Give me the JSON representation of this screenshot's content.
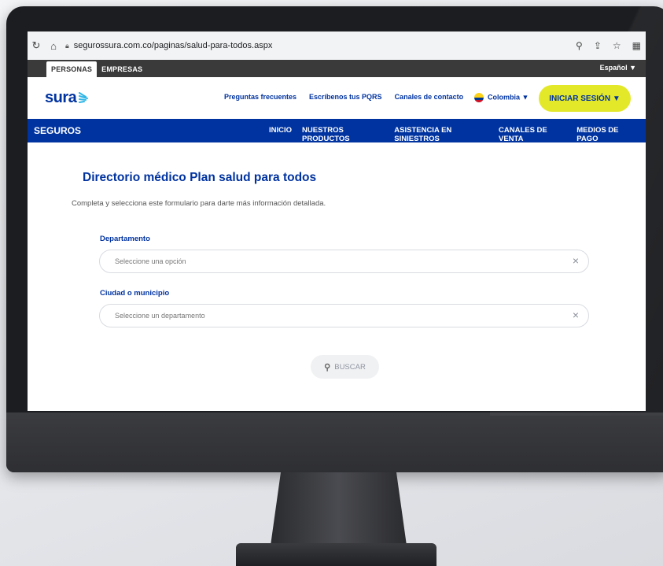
{
  "browser": {
    "url": "segurossura.com.co/paginas/salud-para-todos.aspx",
    "reload_icon": "reload-icon",
    "home_icon": "home-icon"
  },
  "top_bar": {
    "tabs": [
      "PERSONAS",
      "EMPRESAS"
    ],
    "language": "Español ▼"
  },
  "header": {
    "logo": "sura",
    "links": [
      "Preguntas frecuentes",
      "Escríbenos tus PQRS",
      "Canales de contacto"
    ],
    "country": "Colombia ▼",
    "login_button": "INICIAR SESIÓN ▼"
  },
  "nav": {
    "brand": "SEGUROS",
    "items": [
      "INICIO",
      "NUESTROS PRODUCTOS",
      "ASISTENCIA EN SINIESTROS",
      "CANALES DE VENTA",
      "MEDIOS DE PAGO"
    ]
  },
  "main": {
    "title": "Directorio médico Plan salud para todos",
    "subtitle": "Completa y selecciona este formulario para darte más información detallada.",
    "department_label": "Departamento",
    "department_placeholder": "Seleccione una opción",
    "city_label": "Ciudad o municipio",
    "city_placeholder": "Seleccione un departamento",
    "search_button": "BUSCAR"
  },
  "colors": {
    "brand_blue": "#0033a0",
    "accent_yellow": "#e3e829"
  }
}
